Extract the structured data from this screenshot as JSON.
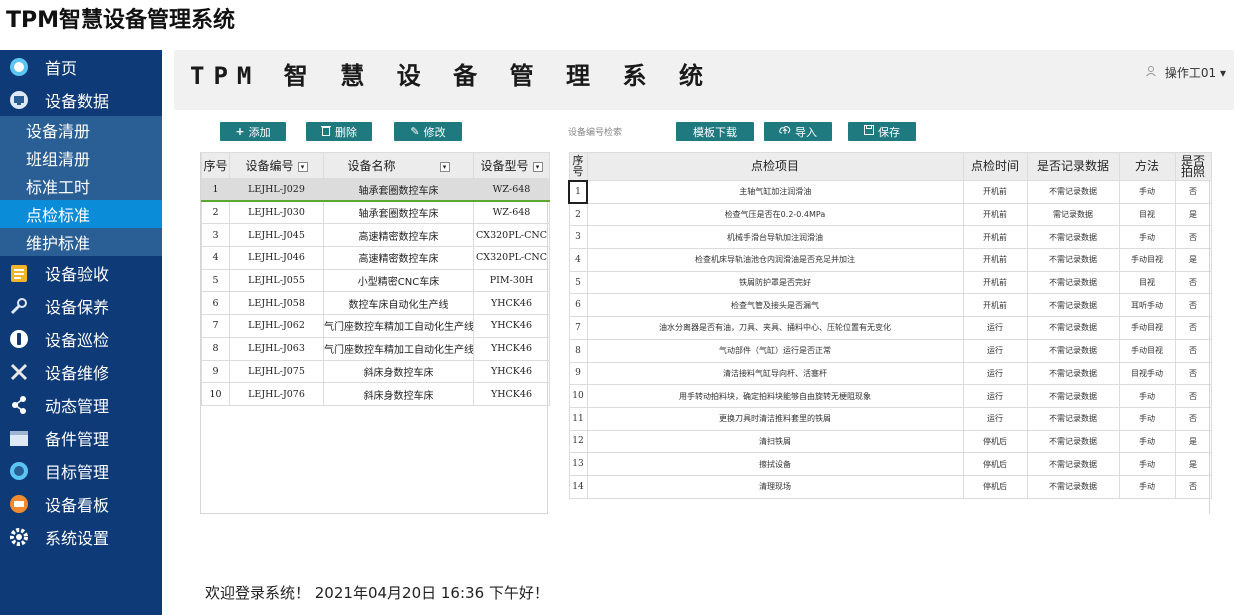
{
  "page_title": "TPM智慧设备管理系统",
  "sidebar": {
    "items": [
      {
        "label": "首页",
        "icon": "home-icon"
      },
      {
        "label": "设备数据",
        "icon": "monitor-icon"
      }
    ],
    "submenu": [
      {
        "label": "设备清册",
        "active": false
      },
      {
        "label": "班组清册",
        "active": false
      },
      {
        "label": "标准工时",
        "active": false
      },
      {
        "label": "点检标准",
        "active": true
      },
      {
        "label": "维护标准",
        "active": false
      }
    ],
    "items2": [
      {
        "label": "设备验收",
        "icon": "clipboard-icon"
      },
      {
        "label": "设备保养",
        "icon": "maintenance-icon"
      },
      {
        "label": "设备巡检",
        "icon": "inspection-icon"
      },
      {
        "label": "设备维修",
        "icon": "wrench-icon"
      },
      {
        "label": "动态管理",
        "icon": "share-icon"
      },
      {
        "label": "备件管理",
        "icon": "calendar-icon"
      },
      {
        "label": "目标管理",
        "icon": "target-icon"
      },
      {
        "label": "设备看板",
        "icon": "board-icon"
      },
      {
        "label": "系统设置",
        "icon": "gear-icon"
      }
    ]
  },
  "header": {
    "system_title": "TPM 智 慧 设 备 管 理 系 统",
    "user": "操作工01 ▾"
  },
  "toolbar": {
    "add": "添加",
    "delete": "删除",
    "edit": "修改",
    "search_label": "设备编号检索",
    "template_download": "模板下载",
    "import": "导入",
    "save": "保存"
  },
  "left_table": {
    "columns": [
      "序号",
      "设备编号",
      "设备名称",
      "设备型号"
    ],
    "rows": [
      [
        "1",
        "LEJHL-J029",
        "轴承套圈数控车床",
        "WZ-648"
      ],
      [
        "2",
        "LEJHL-J030",
        "轴承套圈数控车床",
        "WZ-648"
      ],
      [
        "3",
        "LEJHL-J045",
        "高速精密数控车床",
        "CX320PL-CNC"
      ],
      [
        "4",
        "LEJHL-J046",
        "高速精密数控车床",
        "CX320PL-CNC"
      ],
      [
        "5",
        "LEJHL-J055",
        "小型精密CNC车床",
        "PIM-30H"
      ],
      [
        "6",
        "LEJHL-J058",
        "数控车床自动化生产线",
        "YHCK46"
      ],
      [
        "7",
        "LEJHL-J062",
        "气门座数控车精加工自动化生产线",
        "YHCK46"
      ],
      [
        "8",
        "LEJHL-J063",
        "气门座数控车精加工自动化生产线",
        "YHCK46"
      ],
      [
        "9",
        "LEJHL-J075",
        "斜床身数控车床",
        "YHCK46"
      ],
      [
        "10",
        "LEJHL-J076",
        "斜床身数控车床",
        "YHCK46"
      ]
    ]
  },
  "right_table": {
    "columns": [
      "序号",
      "点检项目",
      "点检时间",
      "是否记录数据",
      "方法",
      "是否拍照"
    ],
    "rows": [
      [
        "1",
        "主轴气缸加注润滑油",
        "开机前",
        "不需记录数据",
        "手动",
        "否"
      ],
      [
        "2",
        "检查气压是否在0.2-0.4MPa",
        "开机前",
        "需记录数据",
        "目视",
        "是"
      ],
      [
        "3",
        "机械手滑台导轨加注润滑油",
        "开机前",
        "不需记录数据",
        "手动",
        "否"
      ],
      [
        "4",
        "检查机床导轨油池仓内润滑油是否充足并加注",
        "开机前",
        "不需记录数据",
        "手动目视",
        "是"
      ],
      [
        "5",
        "铁屑防护罩是否完好",
        "开机前",
        "不需记录数据",
        "目视",
        "否"
      ],
      [
        "6",
        "检查气管及接头是否漏气",
        "开机前",
        "不需记录数据",
        "耳听手动",
        "否"
      ],
      [
        "7",
        "油水分离器是否有油，刀具、夹具、捅料中心、压轮位置有无变化",
        "运行",
        "不需记录数据",
        "手动目视",
        "否"
      ],
      [
        "8",
        "气动部件（气缸）运行是否正常",
        "运行",
        "不需记录数据",
        "手动目视",
        "否"
      ],
      [
        "9",
        "清洁接料气缸导向杆、活塞杆",
        "运行",
        "不需记录数据",
        "目视手动",
        "否"
      ],
      [
        "10",
        "用手转动拍料块，确定拍料块能够自由旋转无梗阻现象",
        "运行",
        "不需记录数据",
        "手动",
        "否"
      ],
      [
        "11",
        "更换刀具时清洁推料套里的铁屑",
        "运行",
        "不需记录数据",
        "手动",
        "否"
      ],
      [
        "12",
        "清扫铁屑",
        "停机后",
        "不需记录数据",
        "手动",
        "是"
      ],
      [
        "13",
        "擦拭设备",
        "停机后",
        "不需记录数据",
        "手动",
        "是"
      ],
      [
        "14",
        "清理现场",
        "停机后",
        "不需记录数据",
        "手动",
        "否"
      ]
    ]
  },
  "welcome": "欢迎登录系统！ 2021年04月20日 16:36 下午好！",
  "colors": {
    "sidebar": "#0e3a78",
    "submenu": "#2a5f96",
    "active": "#0a8cd8",
    "button": "#1f7a80"
  }
}
